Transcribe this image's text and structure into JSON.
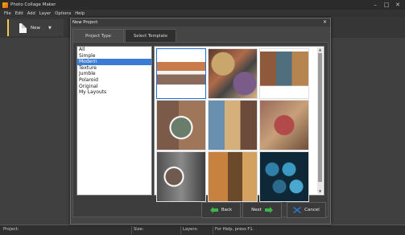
{
  "window": {
    "title": "Photo Collage Maker"
  },
  "menu": [
    "File",
    "Edit",
    "Add",
    "Layer",
    "Options",
    "Help"
  ],
  "toolbar": {
    "new_label": "New"
  },
  "dialog": {
    "title": "New Project",
    "tabs": [
      "Project Type",
      "Select Template"
    ],
    "categories": [
      "All",
      "Simple",
      "Modern",
      "Texture",
      "Jumble",
      "Polaroid",
      "Original",
      "My Layouts"
    ],
    "selected_category": "Modern",
    "buttons": {
      "back": "Back",
      "next": "Next",
      "cancel": "Cancel"
    }
  },
  "status": {
    "project": "Project:",
    "size": "Size:",
    "layers": "Layers:",
    "help": "For Help, press F1."
  },
  "colors": {
    "selection": "#3a7bd5",
    "accent_green": "#3db34a",
    "accent_blue": "#2b7bd6"
  }
}
